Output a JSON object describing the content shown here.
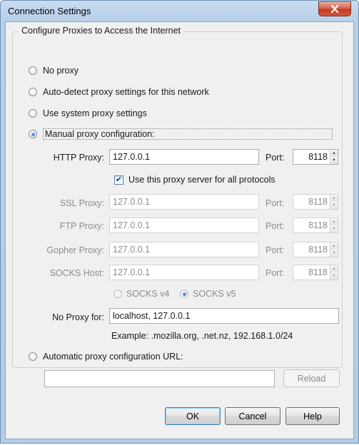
{
  "window": {
    "title": "Connection Settings"
  },
  "group": {
    "legend": "Configure Proxies to Access the Internet",
    "options": {
      "no_proxy": "No proxy",
      "auto_detect": "Auto-detect proxy settings for this network",
      "system": "Use system proxy settings",
      "manual": "Manual proxy configuration:",
      "auto_url": "Automatic proxy configuration URL:"
    },
    "selected": "manual"
  },
  "manual": {
    "port_label": "Port:",
    "http": {
      "label": "HTTP Proxy:",
      "host": "127.0.0.1",
      "port": "8118"
    },
    "use_all": {
      "label": "Use this proxy server for all protocols",
      "checked": true
    },
    "ssl": {
      "label": "SSL Proxy:",
      "host": "127.0.0.1",
      "port": "8118"
    },
    "ftp": {
      "label": "FTP Proxy:",
      "host": "127.0.0.1",
      "port": "8118"
    },
    "gopher": {
      "label": "Gopher Proxy:",
      "host": "127.0.0.1",
      "port": "8118"
    },
    "socks": {
      "label": "SOCKS Host:",
      "host": "127.0.0.1",
      "port": "8118"
    },
    "socks_v4": "SOCKS v4",
    "socks_v5": "SOCKS v5",
    "no_proxy_for": {
      "label": "No Proxy for:",
      "value": "localhost, 127.0.0.1"
    },
    "example": "Example: .mozilla.org, .net.nz, 192.168.1.0/24"
  },
  "auto_url": {
    "value": "",
    "reload_label": "Reload"
  },
  "buttons": {
    "ok": "OK",
    "cancel": "Cancel",
    "help": "Help"
  }
}
